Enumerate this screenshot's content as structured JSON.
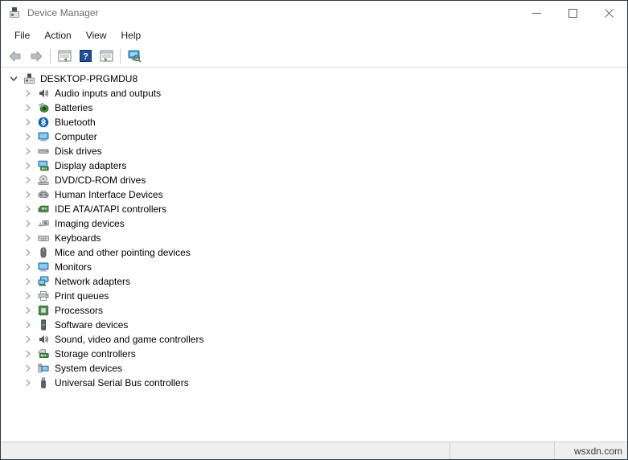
{
  "window": {
    "title": "Device Manager",
    "title_icon": "device-manager-icon",
    "controls": {
      "minimize": "minimize-icon",
      "maximize": "maximize-icon",
      "close": "close-icon"
    }
  },
  "menubar": {
    "items": [
      {
        "label": "File"
      },
      {
        "label": "Action"
      },
      {
        "label": "View"
      },
      {
        "label": "Help"
      }
    ]
  },
  "toolbar": {
    "buttons": [
      {
        "icon": "back-arrow-icon",
        "title": "Back"
      },
      {
        "icon": "forward-arrow-icon",
        "title": "Forward"
      },
      {
        "icon": "separator"
      },
      {
        "icon": "show-hide-console-tree-icon",
        "title": "Show/Hide Console Tree"
      },
      {
        "icon": "help-icon",
        "title": "Help"
      },
      {
        "icon": "properties-icon",
        "title": "Properties"
      },
      {
        "icon": "separator"
      },
      {
        "icon": "scan-for-hardware-changes-icon",
        "title": "Scan for hardware changes"
      }
    ]
  },
  "tree": {
    "root": {
      "label": "DESKTOP-PRGMDU8",
      "icon": "computer-root-icon",
      "expanded": true
    },
    "items": [
      {
        "label": "Audio inputs and outputs",
        "icon": "speaker-icon"
      },
      {
        "label": "Batteries",
        "icon": "battery-icon"
      },
      {
        "label": "Bluetooth",
        "icon": "bluetooth-icon"
      },
      {
        "label": "Computer",
        "icon": "monitor-icon"
      },
      {
        "label": "Disk drives",
        "icon": "disk-drive-icon"
      },
      {
        "label": "Display adapters",
        "icon": "display-adapter-icon"
      },
      {
        "label": "DVD/CD-ROM drives",
        "icon": "dvd-drive-icon"
      },
      {
        "label": "Human Interface Devices",
        "icon": "gamepad-icon"
      },
      {
        "label": "IDE ATA/ATAPI controllers",
        "icon": "ide-controller-icon"
      },
      {
        "label": "Imaging devices",
        "icon": "camera-icon"
      },
      {
        "label": "Keyboards",
        "icon": "keyboard-icon"
      },
      {
        "label": "Mice and other pointing devices",
        "icon": "mouse-icon"
      },
      {
        "label": "Monitors",
        "icon": "monitor-icon"
      },
      {
        "label": "Network adapters",
        "icon": "network-adapter-icon"
      },
      {
        "label": "Print queues",
        "icon": "printer-icon"
      },
      {
        "label": "Processors",
        "icon": "processor-icon"
      },
      {
        "label": "Software devices",
        "icon": "software-device-icon"
      },
      {
        "label": "Sound, video and game controllers",
        "icon": "speaker-icon"
      },
      {
        "label": "Storage controllers",
        "icon": "storage-controller-icon"
      },
      {
        "label": "System devices",
        "icon": "system-device-icon"
      },
      {
        "label": "Universal Serial Bus controllers",
        "icon": "usb-icon"
      }
    ]
  },
  "statusbar": {
    "left_text": "",
    "mid_text": "",
    "watermark": "wsxdn.com"
  },
  "colors": {
    "accent_blue": "#1c7fd6",
    "icon_green": "#3a9b35",
    "icon_gray": "#6d7278",
    "title_text": "#6b6b6b",
    "window_border": "#2b3a47",
    "statusbar_bg": "#efefef"
  }
}
